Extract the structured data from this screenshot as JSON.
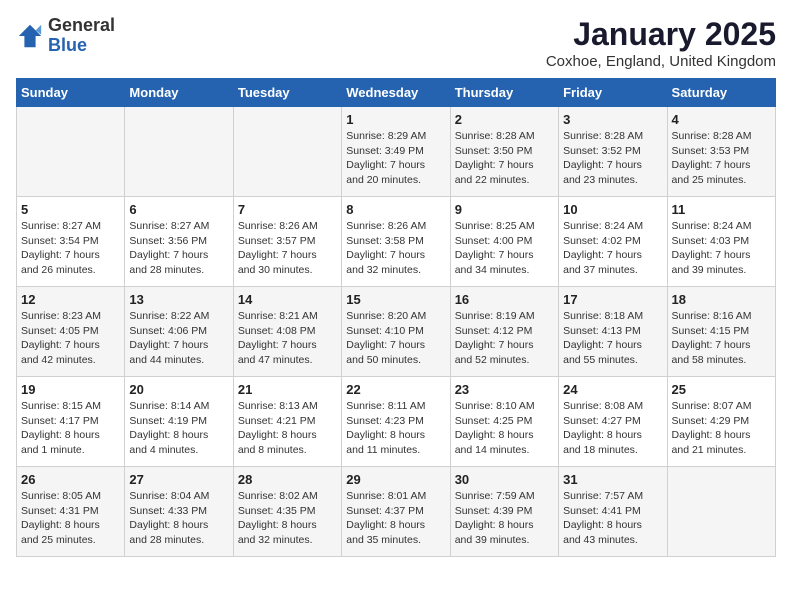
{
  "logo": {
    "general": "General",
    "blue": "Blue"
  },
  "title": "January 2025",
  "subtitle": "Coxhoe, England, United Kingdom",
  "days_of_week": [
    "Sunday",
    "Monday",
    "Tuesday",
    "Wednesday",
    "Thursday",
    "Friday",
    "Saturday"
  ],
  "weeks": [
    [
      {
        "day": "",
        "info": ""
      },
      {
        "day": "",
        "info": ""
      },
      {
        "day": "",
        "info": ""
      },
      {
        "day": "1",
        "info": "Sunrise: 8:29 AM\nSunset: 3:49 PM\nDaylight: 7 hours\nand 20 minutes."
      },
      {
        "day": "2",
        "info": "Sunrise: 8:28 AM\nSunset: 3:50 PM\nDaylight: 7 hours\nand 22 minutes."
      },
      {
        "day": "3",
        "info": "Sunrise: 8:28 AM\nSunset: 3:52 PM\nDaylight: 7 hours\nand 23 minutes."
      },
      {
        "day": "4",
        "info": "Sunrise: 8:28 AM\nSunset: 3:53 PM\nDaylight: 7 hours\nand 25 minutes."
      }
    ],
    [
      {
        "day": "5",
        "info": "Sunrise: 8:27 AM\nSunset: 3:54 PM\nDaylight: 7 hours\nand 26 minutes."
      },
      {
        "day": "6",
        "info": "Sunrise: 8:27 AM\nSunset: 3:56 PM\nDaylight: 7 hours\nand 28 minutes."
      },
      {
        "day": "7",
        "info": "Sunrise: 8:26 AM\nSunset: 3:57 PM\nDaylight: 7 hours\nand 30 minutes."
      },
      {
        "day": "8",
        "info": "Sunrise: 8:26 AM\nSunset: 3:58 PM\nDaylight: 7 hours\nand 32 minutes."
      },
      {
        "day": "9",
        "info": "Sunrise: 8:25 AM\nSunset: 4:00 PM\nDaylight: 7 hours\nand 34 minutes."
      },
      {
        "day": "10",
        "info": "Sunrise: 8:24 AM\nSunset: 4:02 PM\nDaylight: 7 hours\nand 37 minutes."
      },
      {
        "day": "11",
        "info": "Sunrise: 8:24 AM\nSunset: 4:03 PM\nDaylight: 7 hours\nand 39 minutes."
      }
    ],
    [
      {
        "day": "12",
        "info": "Sunrise: 8:23 AM\nSunset: 4:05 PM\nDaylight: 7 hours\nand 42 minutes."
      },
      {
        "day": "13",
        "info": "Sunrise: 8:22 AM\nSunset: 4:06 PM\nDaylight: 7 hours\nand 44 minutes."
      },
      {
        "day": "14",
        "info": "Sunrise: 8:21 AM\nSunset: 4:08 PM\nDaylight: 7 hours\nand 47 minutes."
      },
      {
        "day": "15",
        "info": "Sunrise: 8:20 AM\nSunset: 4:10 PM\nDaylight: 7 hours\nand 50 minutes."
      },
      {
        "day": "16",
        "info": "Sunrise: 8:19 AM\nSunset: 4:12 PM\nDaylight: 7 hours\nand 52 minutes."
      },
      {
        "day": "17",
        "info": "Sunrise: 8:18 AM\nSunset: 4:13 PM\nDaylight: 7 hours\nand 55 minutes."
      },
      {
        "day": "18",
        "info": "Sunrise: 8:16 AM\nSunset: 4:15 PM\nDaylight: 7 hours\nand 58 minutes."
      }
    ],
    [
      {
        "day": "19",
        "info": "Sunrise: 8:15 AM\nSunset: 4:17 PM\nDaylight: 8 hours\nand 1 minute."
      },
      {
        "day": "20",
        "info": "Sunrise: 8:14 AM\nSunset: 4:19 PM\nDaylight: 8 hours\nand 4 minutes."
      },
      {
        "day": "21",
        "info": "Sunrise: 8:13 AM\nSunset: 4:21 PM\nDaylight: 8 hours\nand 8 minutes."
      },
      {
        "day": "22",
        "info": "Sunrise: 8:11 AM\nSunset: 4:23 PM\nDaylight: 8 hours\nand 11 minutes."
      },
      {
        "day": "23",
        "info": "Sunrise: 8:10 AM\nSunset: 4:25 PM\nDaylight: 8 hours\nand 14 minutes."
      },
      {
        "day": "24",
        "info": "Sunrise: 8:08 AM\nSunset: 4:27 PM\nDaylight: 8 hours\nand 18 minutes."
      },
      {
        "day": "25",
        "info": "Sunrise: 8:07 AM\nSunset: 4:29 PM\nDaylight: 8 hours\nand 21 minutes."
      }
    ],
    [
      {
        "day": "26",
        "info": "Sunrise: 8:05 AM\nSunset: 4:31 PM\nDaylight: 8 hours\nand 25 minutes."
      },
      {
        "day": "27",
        "info": "Sunrise: 8:04 AM\nSunset: 4:33 PM\nDaylight: 8 hours\nand 28 minutes."
      },
      {
        "day": "28",
        "info": "Sunrise: 8:02 AM\nSunset: 4:35 PM\nDaylight: 8 hours\nand 32 minutes."
      },
      {
        "day": "29",
        "info": "Sunrise: 8:01 AM\nSunset: 4:37 PM\nDaylight: 8 hours\nand 35 minutes."
      },
      {
        "day": "30",
        "info": "Sunrise: 7:59 AM\nSunset: 4:39 PM\nDaylight: 8 hours\nand 39 minutes."
      },
      {
        "day": "31",
        "info": "Sunrise: 7:57 AM\nSunset: 4:41 PM\nDaylight: 8 hours\nand 43 minutes."
      },
      {
        "day": "",
        "info": ""
      }
    ]
  ]
}
